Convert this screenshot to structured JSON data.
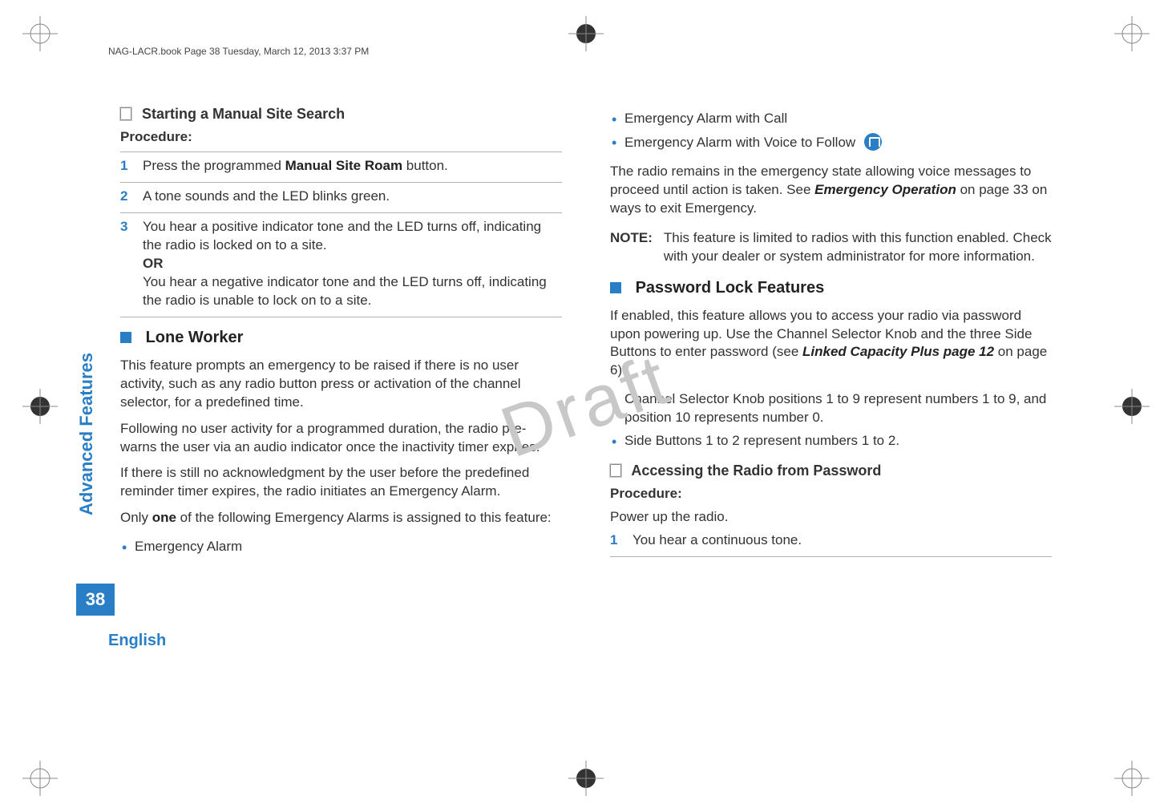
{
  "header": "NAG-LACR.book  Page 38  Tuesday, March 12, 2013  3:37 PM",
  "watermark": "Draft",
  "side_tab": "Advanced Features",
  "page_number": "38",
  "language": "English",
  "left": {
    "h1": "Starting a Manual Site Search",
    "procedure_label": "Procedure:",
    "steps": [
      {
        "n": "1",
        "text_a": "Press the programmed ",
        "bold": "Manual Site Roam",
        "text_b": " button."
      },
      {
        "n": "2",
        "text_a": "A tone sounds and the LED blinks green.",
        "bold": "",
        "text_b": ""
      },
      {
        "n": "3",
        "text_a": "You hear a positive indicator tone and the LED turns off, indicating the radio is locked on to a site.",
        "or": "OR",
        "text_b": "You hear a negative indicator tone and the LED turns off, indicating the radio is unable to lock on to a site."
      }
    ],
    "h2": "Lone Worker",
    "p1": "This feature prompts an emergency to be raised if there is no user activity, such as any radio button press or activation of the channel selector, for a predefined time.",
    "p2": "Following no user activity for a programmed duration, the radio pre-warns the user via an audio indicator once the inactivity timer expires.",
    "p3": "If there is still no acknowledgment by the user before the predefined reminder timer expires, the radio initiates an Emergency Alarm.",
    "p4_a": "Only ",
    "p4_bold": "one",
    "p4_b": " of the following Emergency Alarms is assigned to this feature:",
    "list1": "Emergency Alarm"
  },
  "right": {
    "list2": "Emergency Alarm with Call",
    "list3": "Emergency Alarm with Voice to Follow",
    "p1_a": "The radio remains in the emergency state allowing voice messages to proceed until action is taken. See ",
    "p1_bold": "Emergency Operation",
    "p1_b": " on page 33 on ways to exit Emergency.",
    "note_label": "NOTE:",
    "note_text": "This feature is limited to radios with this function enabled. Check with your dealer or system administrator for more information.",
    "h1": "Password Lock Features",
    "p2_a": "If enabled, this feature allows you to access your radio via password upon powering up. Use the Channel Selector Knob and the three Side Buttons to enter password (see ",
    "p2_bold": "Linked Capacity Plus page 12",
    "p2_b": " on page 6):",
    "bul1": "Channel Selector Knob positions 1 to 9 represent numbers 1 to 9, and position 10 represents number 0.",
    "bul2": "Side Buttons 1 to 2 represent numbers 1 to 2.",
    "h2": "Accessing the Radio from Password",
    "procedure_label": "Procedure:",
    "proc_sub": "Power up the radio.",
    "step1_n": "1",
    "step1_text": "You hear a continuous tone."
  }
}
